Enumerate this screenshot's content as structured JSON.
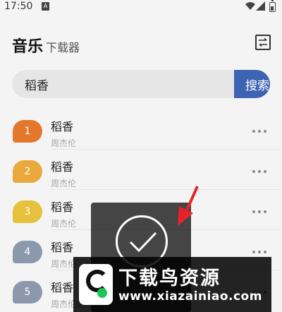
{
  "status_bar": {
    "time": "17:50",
    "notification_glyph": "A"
  },
  "header": {
    "title": "音乐",
    "subtitle": "下载器"
  },
  "search": {
    "value": "稻香",
    "button_label": "搜索"
  },
  "songs": [
    {
      "index": "1",
      "name": "稻香",
      "artist": "周杰伦",
      "color": "#e3782b"
    },
    {
      "index": "2",
      "name": "稻香",
      "artist": "周杰伦",
      "color": "#e9a93c"
    },
    {
      "index": "3",
      "name": "稻香",
      "artist": "周杰伦",
      "color": "#e7c13b"
    },
    {
      "index": "4",
      "name": "稻香",
      "artist": "周杰伦",
      "color": "#8c99ad"
    },
    {
      "index": "5",
      "name": "稻香",
      "artist": "周杰伦&温岚",
      "color": "#8c99ad"
    }
  ],
  "watermark": {
    "title": "下载鸟资源",
    "url": "www.xiazainiao.com"
  },
  "colors": {
    "accent": "#3f63b3",
    "annotation_arrow": "#e8222c"
  }
}
